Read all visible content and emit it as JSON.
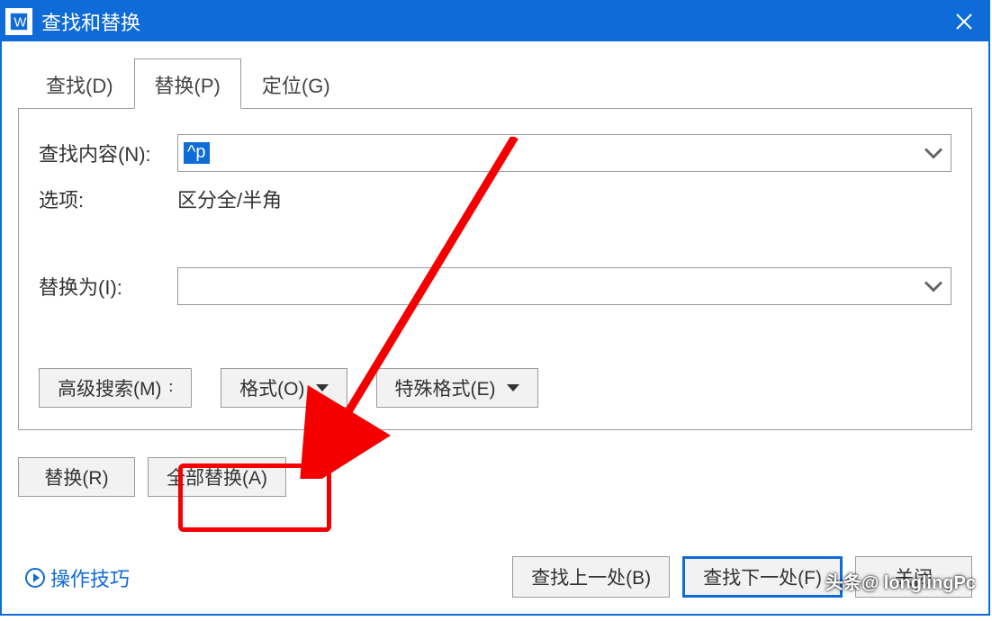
{
  "window": {
    "title": "查找和替换"
  },
  "tabs": {
    "find": "查找(D)",
    "replace": "替换(P)",
    "goto": "定位(G)"
  },
  "form": {
    "find_label": "查找内容(N):",
    "find_value": "^p",
    "options_label": "选项:",
    "options_value": "区分全/半角",
    "replace_label": "替换为(I):",
    "replace_value": ""
  },
  "toolbar": {
    "advanced_search": "高级搜索(M)",
    "format": "格式(O)",
    "special_format": "特殊格式(E)"
  },
  "buttons": {
    "replace": "替换(R)",
    "replace_all": "全部替换(A)",
    "find_prev": "查找上一处(B)",
    "find_next": "查找下一处(F)",
    "close": "关闭"
  },
  "link": {
    "tips": "操作技巧"
  },
  "watermark": "头条@ longlingPc"
}
